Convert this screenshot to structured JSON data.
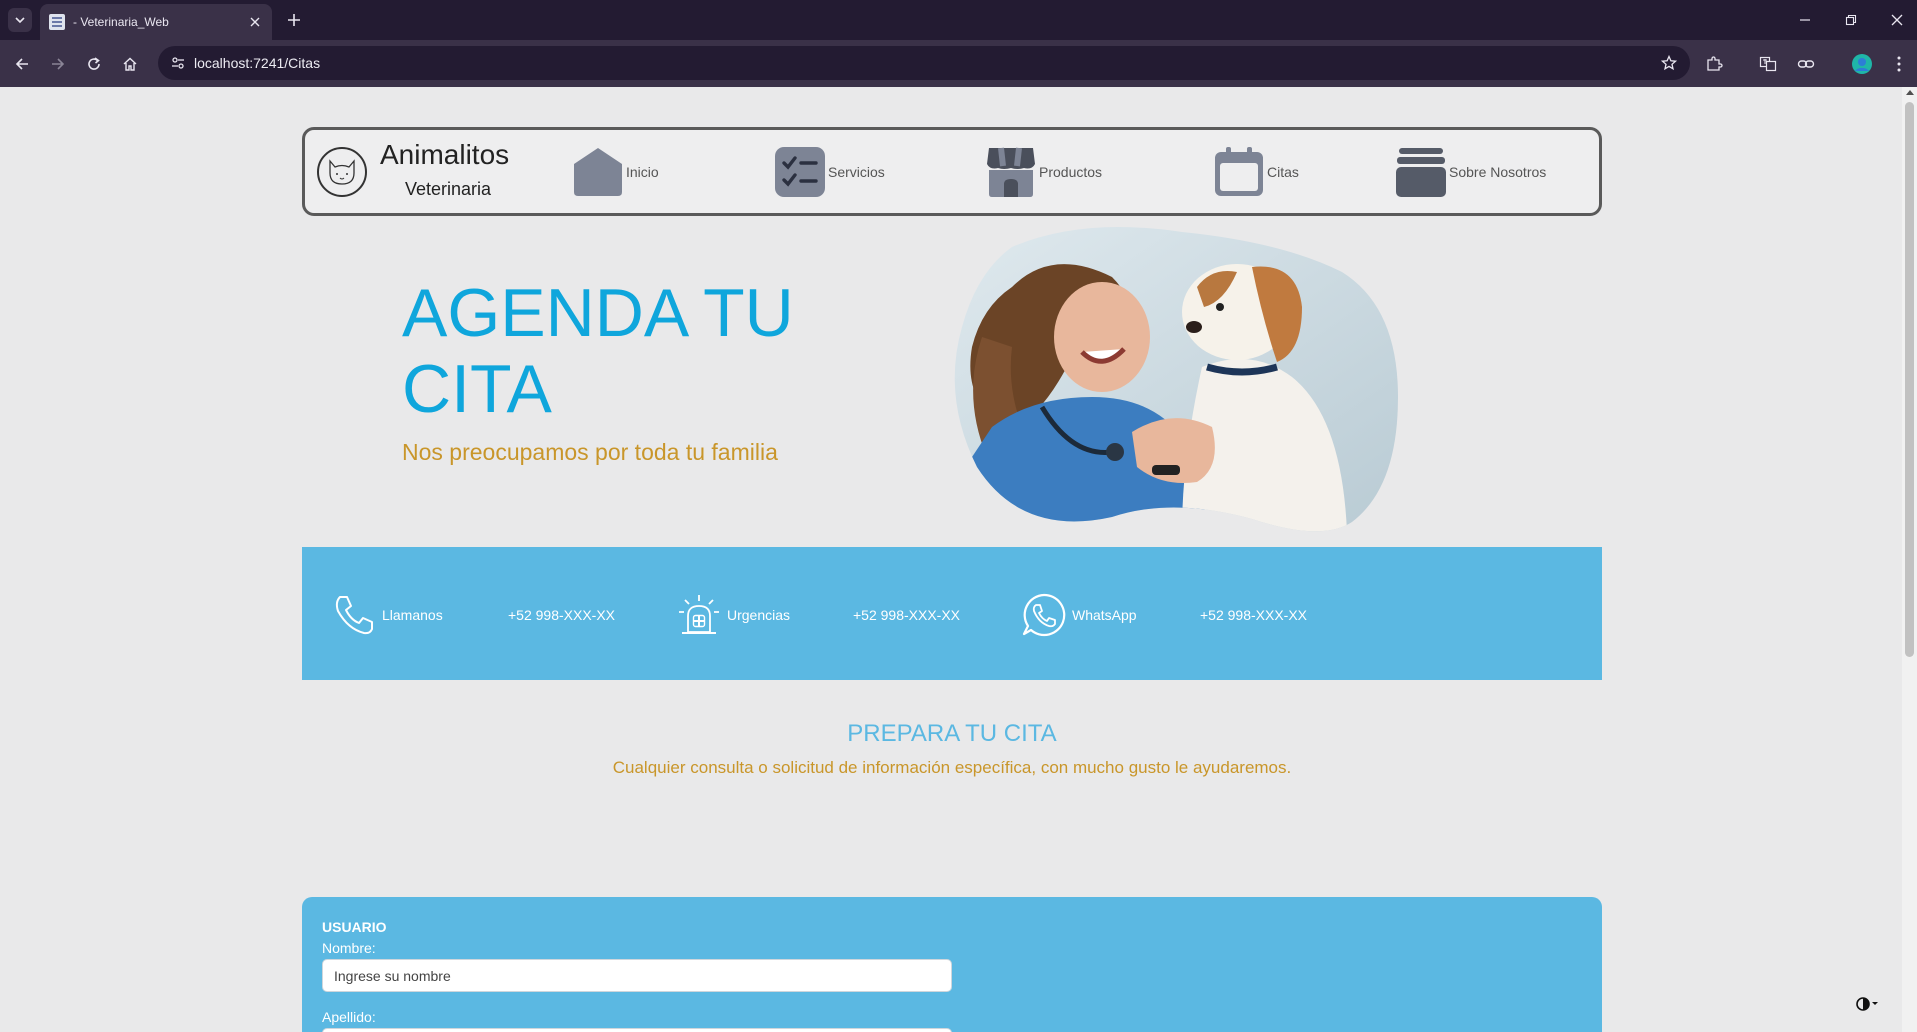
{
  "browser": {
    "tab_title": "- Veterinaria_Web",
    "url": "localhost:7241/Citas"
  },
  "nav": {
    "brand": "Animalitos",
    "brand_sub": "Veterinaria",
    "items": [
      {
        "label": "Inicio",
        "icon": "home-icon"
      },
      {
        "label": "Servicios",
        "icon": "checklist-icon"
      },
      {
        "label": "Productos",
        "icon": "store-icon"
      },
      {
        "label": "Citas",
        "icon": "calendar-icon"
      },
      {
        "label": "Sobre Nosotros",
        "icon": "archive-icon"
      }
    ]
  },
  "hero": {
    "title": "AGENDA TU CITA",
    "subtitle": "Nos preocupamos por toda tu familia"
  },
  "contact": {
    "items": [
      {
        "label": "Llamanos",
        "phone": "+52 998-XXX-XX",
        "icon": "phone-icon"
      },
      {
        "label": "Urgencias",
        "phone": "+52 998-XXX-XX",
        "icon": "emergency-siren-icon"
      },
      {
        "label": "WhatsApp",
        "phone": "+52 998-XXX-XX",
        "icon": "whatsapp-icon"
      }
    ]
  },
  "prepare": {
    "title": "PREPARA TU CITA",
    "subtitle": "Cualquier consulta o solicitud de información específica, con mucho gusto le ayudaremos."
  },
  "form": {
    "section": "USUARIO",
    "name_label": "Nombre:",
    "name_placeholder": "Ingrese su nombre",
    "lastname_label": "Apellido:"
  },
  "colors": {
    "primary_blue": "#0fa6dc",
    "band_blue": "#5bb8e2",
    "accent_gold": "#c9962a",
    "browser_dark": "#231b32"
  }
}
